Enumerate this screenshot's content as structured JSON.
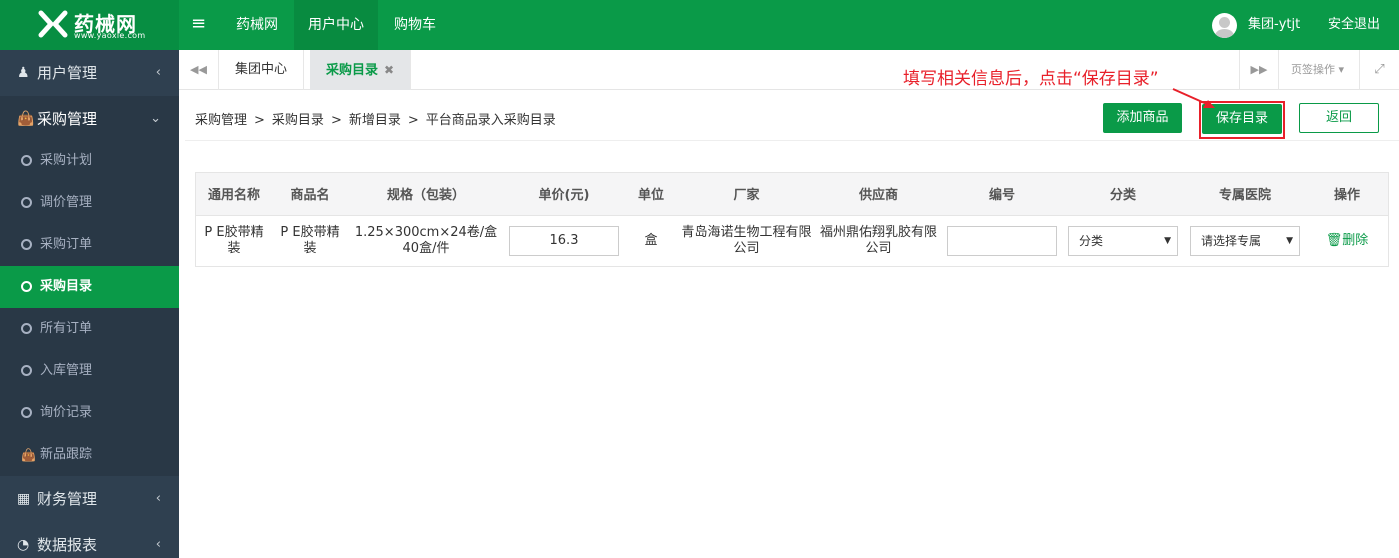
{
  "brand": {
    "name": "药械网",
    "sub": "www.yaoxie.com"
  },
  "topnav": {
    "menu_icon": "hamburger-icon",
    "items": [
      "药械网",
      "用户中心",
      "购物车"
    ],
    "active": "用户中心"
  },
  "user": {
    "name": "集团-ytjt",
    "logout": "安全退出"
  },
  "sidebar": {
    "groups": [
      {
        "label": "用户管理",
        "icon": "user-icon",
        "arrow": "‹"
      },
      {
        "label": "采购管理",
        "icon": "shopping-bag-icon",
        "arrow": "⌄"
      },
      {
        "label": "财务管理",
        "icon": "calculator-icon",
        "arrow": "‹"
      },
      {
        "label": "数据报表",
        "icon": "pie-chart-icon",
        "arrow": "‹"
      }
    ],
    "items": [
      "采购计划",
      "调价管理",
      "采购订单",
      "采购目录",
      "所有订单",
      "入库管理",
      "询价记录",
      "新品跟踪"
    ],
    "active_item": "采购目录"
  },
  "tabs": {
    "prev": "◀◀",
    "next": "▶▶",
    "items": [
      {
        "label": "集团中心"
      },
      {
        "label": "采购目录",
        "close": "✖"
      }
    ],
    "tools_label": "页签操作",
    "fullscreen_icon": "expand-icon"
  },
  "breadcrumb": [
    "采购管理",
    "采购目录",
    "新增目录",
    "平台商品录入采购目录"
  ],
  "breadcrumb_sep": ">",
  "actions": {
    "add_product": "添加商品",
    "save_catalog": "保存目录",
    "back": "返回"
  },
  "annotation": "填写相关信息后，点击“保存目录”",
  "table": {
    "headers": [
      "通用名称",
      "商品名",
      "规格（包装）",
      "单价(元)",
      "单位",
      "厂家",
      "供应商",
      "编号",
      "分类",
      "专属医院",
      "操作"
    ],
    "row": {
      "generic_name": "P E胶带精装",
      "product_name": "P E胶带精装",
      "spec": "1.25×300cm×24卷/盒 40盒/件",
      "price": "16.3",
      "unit": "盒",
      "manufacturer": "青岛海诺生物工程有限公司",
      "supplier": "福州鼎佑翔乳胶有限公司",
      "code": "",
      "category": "分类",
      "hospital": "请选择专属",
      "delete": "删除"
    }
  },
  "colors": {
    "brand_green": "#0a9a48",
    "sidebar_bg": "#2f4050",
    "annotation_red": "#e8202a"
  }
}
